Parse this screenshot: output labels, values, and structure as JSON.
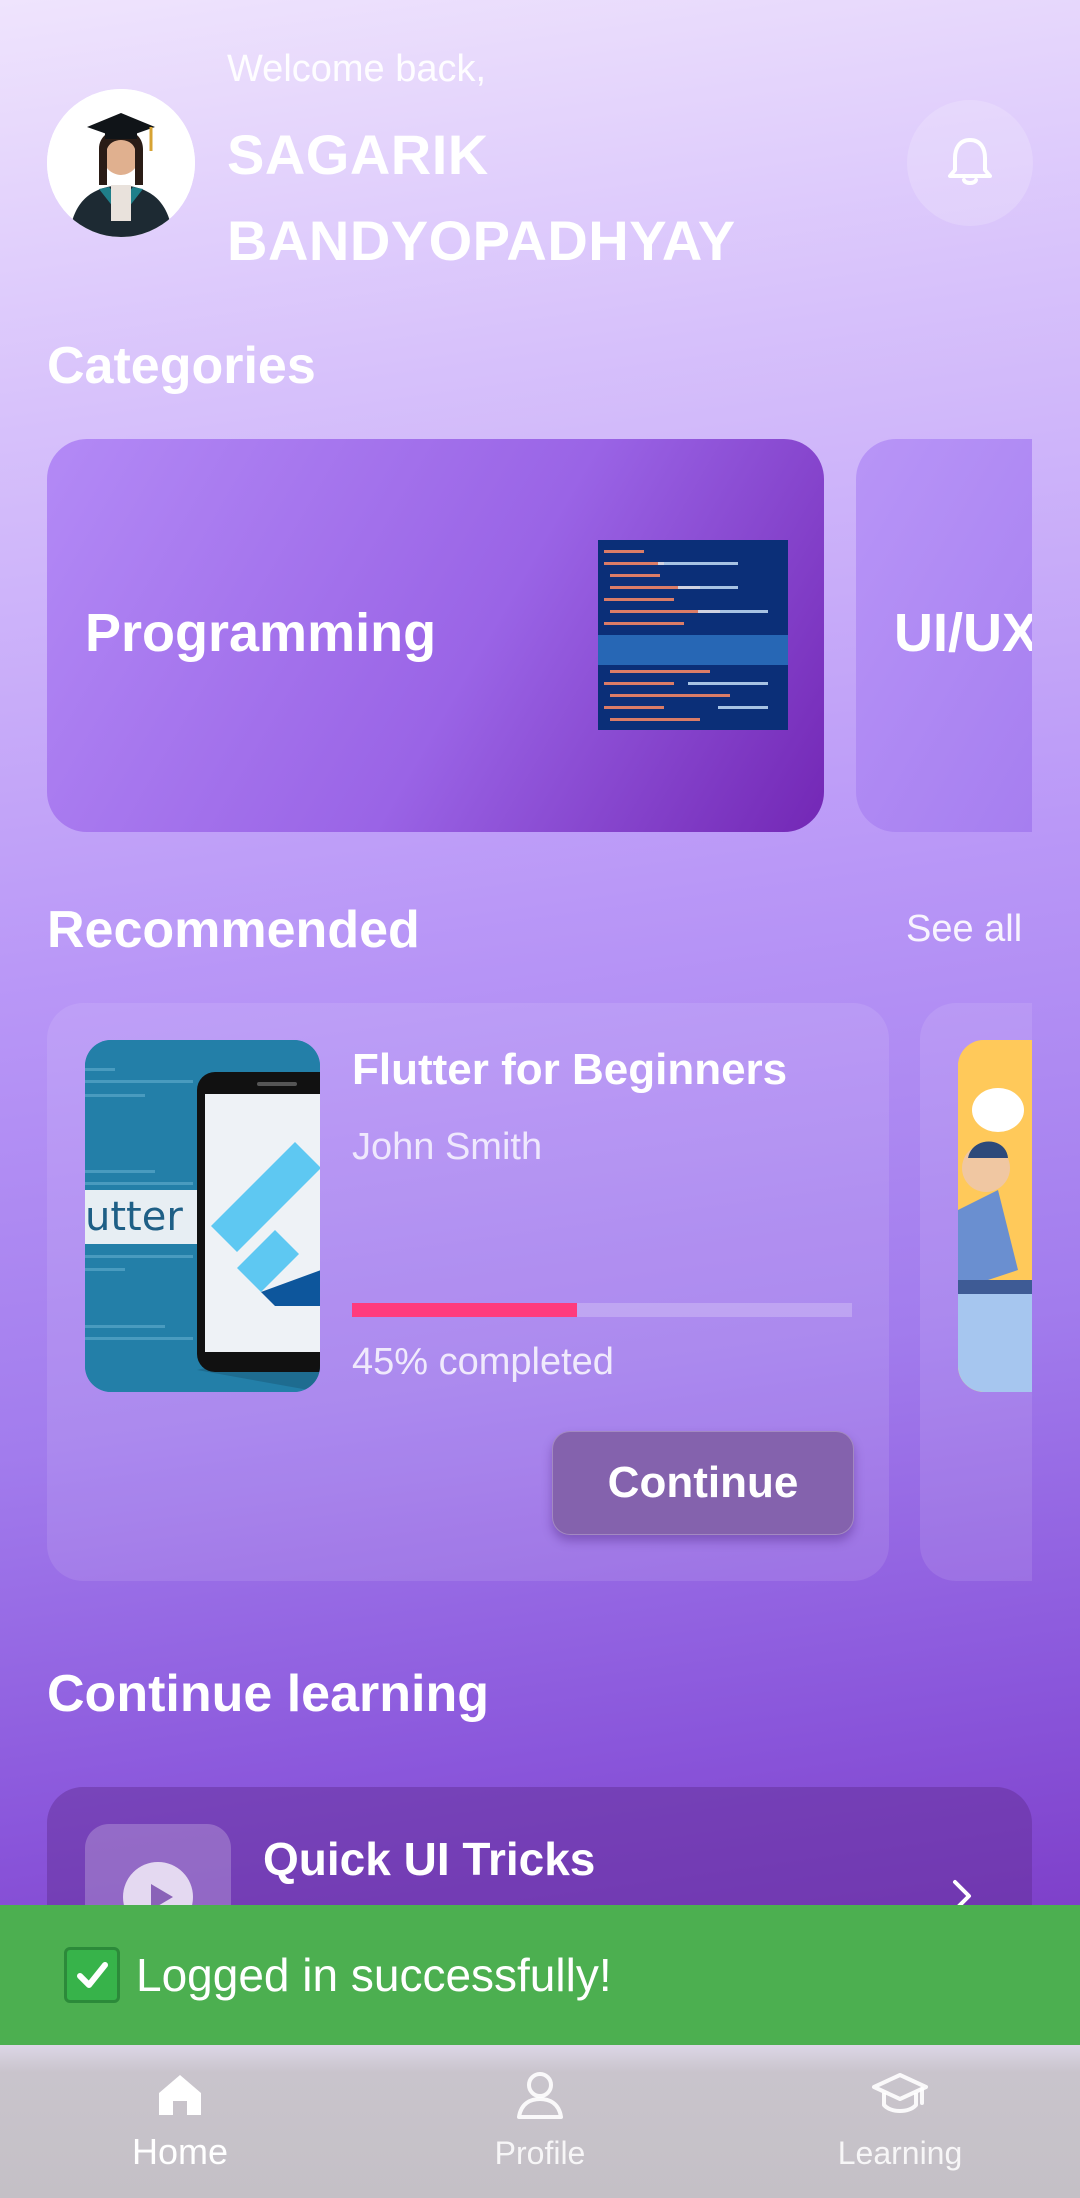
{
  "header": {
    "welcome_text": "Welcome back,",
    "user_name": "SAGARIK BANDYOPADHYAY"
  },
  "categories": {
    "title": "Categories",
    "items": [
      {
        "label": "Programming",
        "icon": "code-image"
      },
      {
        "label": "UI/UX"
      }
    ]
  },
  "recommended": {
    "title": "Recommended",
    "see_all_label": "See all",
    "courses": [
      {
        "title": "Flutter for Beginners",
        "author": "John Smith",
        "progress": 0.45,
        "progress_label": "45% completed",
        "continue_label": "Continue",
        "image_text": "utter"
      }
    ]
  },
  "continue_learning": {
    "title": "Continue learning",
    "items": [
      {
        "title": "Quick UI Tricks"
      }
    ]
  },
  "snackbar": {
    "message": "Logged in successfully!"
  },
  "bottom_nav": {
    "items": [
      {
        "label": "Home",
        "icon": "home-icon",
        "active": true
      },
      {
        "label": "Profile",
        "icon": "person-icon"
      },
      {
        "label": "Learning",
        "icon": "graduation-cap-icon"
      }
    ]
  },
  "colors": {
    "progress_fill": "#ff3b7d",
    "snackbar_bg": "#4caf50",
    "continue_button": "#8462ad"
  }
}
